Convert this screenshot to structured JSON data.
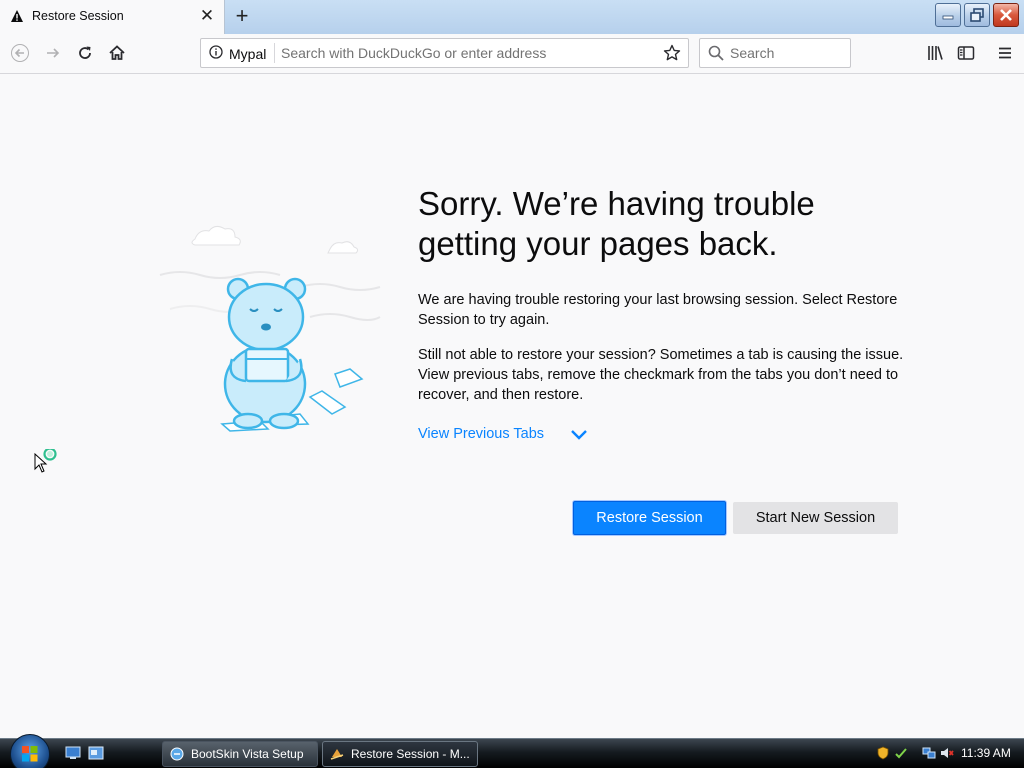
{
  "tab": {
    "title": "Restore Session",
    "icon": "warning-icon"
  },
  "toolbar": {
    "identity_label": "Mypal",
    "url_placeholder": "Search with DuckDuckGo or enter address",
    "search_placeholder": "Search"
  },
  "content": {
    "heading": "Sorry. We’re having trouble getting your pages back.",
    "paragraph1": "We are having trouble restoring your last browsing session. Select Restore Session to try again.",
    "paragraph2": "Still not able to restore your session? Sometimes a tab is causing the issue. View previous tabs, remove the checkmark from the tabs you don’t need to recover, and then restore.",
    "view_tabs_label": "View Previous Tabs",
    "restore_button": "Restore Session",
    "new_session_button": "Start New Session"
  },
  "taskbar": {
    "items": [
      {
        "label": "BootSkin Vista Setup"
      },
      {
        "label": "Restore Session - M..."
      }
    ],
    "clock": "11:39 AM"
  },
  "colors": {
    "accent": "#0a84ff",
    "page_bg": "#f9f9fa",
    "secondary_button": "#e3e3e5"
  }
}
